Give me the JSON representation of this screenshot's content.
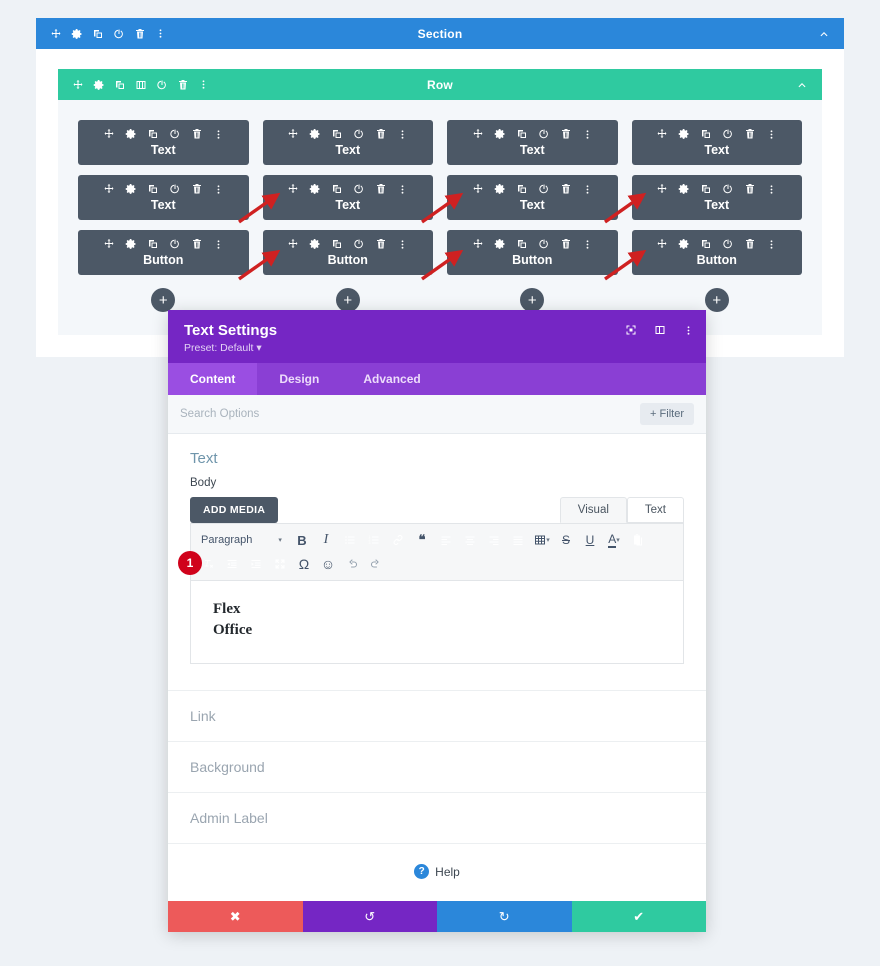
{
  "builder": {
    "section": {
      "label": "Section",
      "tools": [
        "move-icon",
        "gear-icon",
        "duplicate-icon",
        "power-icon",
        "trash-icon",
        "more-icon"
      ],
      "collapse": "chevron-up-icon"
    },
    "row": {
      "label": "Row",
      "tools": [
        "move-icon",
        "gear-icon",
        "duplicate-icon",
        "columns-icon",
        "power-icon",
        "trash-icon",
        "more-icon"
      ],
      "collapse": "chevron-up-icon"
    },
    "module_tools": [
      "move-icon",
      "gear-icon",
      "duplicate-icon",
      "power-icon",
      "trash-icon",
      "more-icon"
    ],
    "columns": [
      {
        "modules": [
          "Text",
          "Text",
          "Button"
        ],
        "add_label": "+"
      },
      {
        "modules": [
          "Text",
          "Text",
          "Button"
        ],
        "add_label": "+"
      },
      {
        "modules": [
          "Text",
          "Text",
          "Button"
        ],
        "add_label": "+"
      },
      {
        "modules": [
          "Text",
          "Text",
          "Button"
        ],
        "add_label": "+"
      }
    ]
  },
  "modal": {
    "title": "Text Settings",
    "preset": "Preset: Default",
    "preset_caret": "▾",
    "head_icons": [
      "fullscreen-icon",
      "split-view-icon",
      "more-icon"
    ],
    "tabs": [
      {
        "label": "Content",
        "active": true
      },
      {
        "label": "Design",
        "active": false
      },
      {
        "label": "Advanced",
        "active": false
      }
    ],
    "search": {
      "placeholder": "Search Options",
      "value": ""
    },
    "filter_label": "Filter",
    "filter_plus": "+",
    "section": {
      "title": "Text",
      "collapse_icon": "chevron-up-icon",
      "more_icon": "more-icon"
    },
    "body_field": {
      "label": "Body",
      "add_media": "ADD MEDIA",
      "editor_tabs": [
        {
          "label": "Visual",
          "active": true
        },
        {
          "label": "Text",
          "active": false
        }
      ],
      "toolbar_row1": [
        {
          "name": "format-select",
          "label": "Paragraph",
          "caret": "▾"
        },
        {
          "name": "bold-icon",
          "glyph": "B"
        },
        {
          "name": "italic-icon",
          "glyph": "I"
        },
        {
          "name": "bullet-list-icon",
          "glyph": ""
        },
        {
          "name": "numbered-list-icon",
          "glyph": ""
        },
        {
          "name": "link-icon",
          "glyph": ""
        },
        {
          "name": "blockquote-icon",
          "glyph": "❝"
        },
        {
          "name": "align-left-icon",
          "glyph": ""
        },
        {
          "name": "align-center-icon",
          "glyph": ""
        },
        {
          "name": "align-right-icon",
          "glyph": ""
        },
        {
          "name": "align-justify-icon",
          "glyph": ""
        },
        {
          "name": "table-icon",
          "glyph": "",
          "caret": "▾"
        },
        {
          "name": "strikethrough-icon",
          "glyph": "S"
        },
        {
          "name": "underline-icon",
          "glyph": "U"
        },
        {
          "name": "text-color-icon",
          "glyph": "A",
          "caret": "▾"
        },
        {
          "name": "paste-as-text-icon",
          "glyph": ""
        }
      ],
      "toolbar_row2": [
        {
          "name": "clear-formatting-icon",
          "glyph": "I"
        },
        {
          "name": "outdent-icon",
          "glyph": ""
        },
        {
          "name": "indent-icon",
          "glyph": ""
        },
        {
          "name": "fullscreen-icon",
          "glyph": ""
        },
        {
          "name": "special-character-icon",
          "glyph": "Ω"
        },
        {
          "name": "emoji-icon",
          "glyph": "☺"
        },
        {
          "name": "undo-icon",
          "glyph": "↰"
        },
        {
          "name": "redo-icon",
          "glyph": "↱"
        }
      ],
      "content_lines": [
        "Flex",
        "Office"
      ]
    },
    "toggles": [
      {
        "label": "Link",
        "chevron": "chevron-down-icon"
      },
      {
        "label": "Background",
        "chevron": "chevron-down-icon"
      },
      {
        "label": "Admin Label",
        "chevron": "chevron-down-icon"
      }
    ],
    "help": {
      "icon_glyph": "?",
      "label": "Help"
    },
    "footer": [
      {
        "name": "cancel-button",
        "glyph": "✖",
        "color": "#ed5a5a"
      },
      {
        "name": "undo-button",
        "glyph": "↺",
        "color": "#7526c4"
      },
      {
        "name": "redo-button",
        "glyph": "↻",
        "color": "#2b87da"
      },
      {
        "name": "save-button",
        "glyph": "✔",
        "color": "#2fcaa0"
      }
    ]
  },
  "annotations": {
    "badge_number": "1",
    "arrow_color": "#cf2121",
    "arrow_count": 6
  },
  "colors": {
    "page_bg": "#eef2f6",
    "section_bar": "#2b87da",
    "row_bar": "#2fcaa0",
    "module_bg": "#4c5866",
    "modal_header": "#7526c4",
    "tab_bar": "#8a3fd4",
    "badge": "#d0021b"
  }
}
